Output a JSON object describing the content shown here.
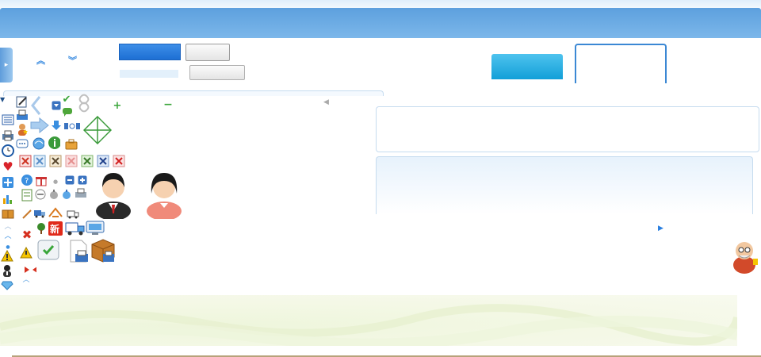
{
  "header": {
    "title": ""
  },
  "toolbar": {
    "expand_up": "↑",
    "expand_down": "↓",
    "add_symbol": "+",
    "remove_symbol": "−",
    "side_tab_arrow": "▸"
  },
  "colors": {
    "header": "#6eaee6",
    "primary_button": "#2a7fe0",
    "active_tab": "#27b0e4",
    "tab_border": "#3b88d4",
    "banner": "#f1f7e1"
  },
  "icons": [
    "pencil-icon",
    "printer-icon",
    "list-icon",
    "user-star-icon",
    "clock-icon",
    "heart-icon",
    "plus-blue-icon",
    "chart-icon",
    "box-icon",
    "warning-icon",
    "person-icon",
    "diamond-icon",
    "checkmark-icon",
    "chat-icon",
    "info-icon",
    "bag-icon",
    "delete-x-icon",
    "gift-icon",
    "help-icon",
    "truck-icon",
    "tree-icon",
    "new-badge-icon",
    "envelope-icon"
  ]
}
